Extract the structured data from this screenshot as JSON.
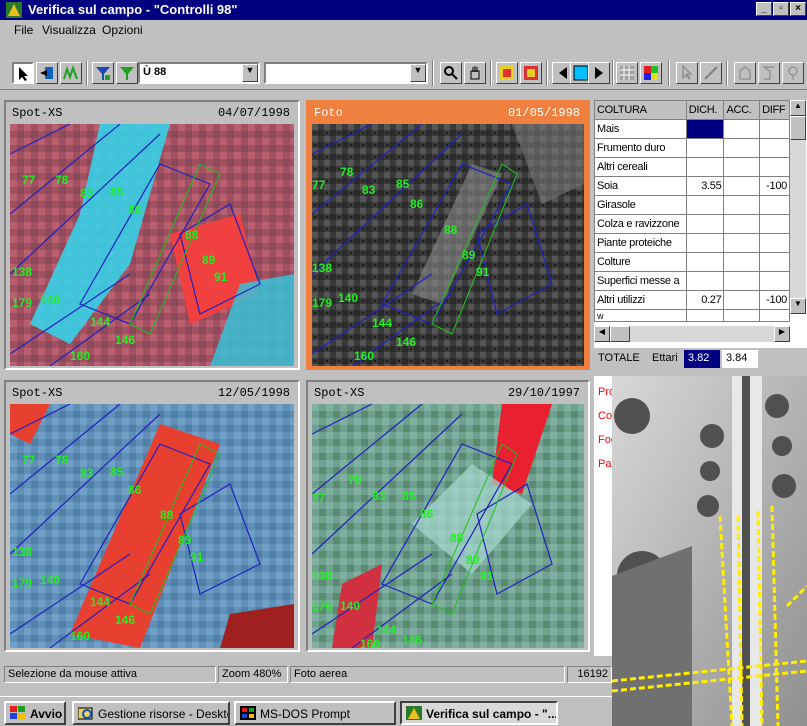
{
  "window": {
    "title": "Verifica sul campo - \"Controlli 98\""
  },
  "menu": [
    {
      "label": "File"
    },
    {
      "label": "Visualizza"
    },
    {
      "label": "Opzioni"
    }
  ],
  "toolbar": {
    "layer_combo": "Ù 88",
    "combo2": "",
    "combo3": ""
  },
  "panels": [
    {
      "label": "Spot-XS",
      "date": "04/07/1998"
    },
    {
      "label": "Foto",
      "date": "01/05/1998"
    },
    {
      "label": "Spot-XS",
      "date": "12/05/1998"
    },
    {
      "label": "Spot-XS",
      "date": "29/10/1997"
    }
  ],
  "parcel_labels": [
    "77",
    "78",
    "83",
    "85",
    "86",
    "88",
    "89",
    "91",
    "138",
    "179",
    "140",
    "144",
    "146",
    "160"
  ],
  "table": {
    "headers": [
      "COLTURA",
      "DICH.",
      "ACC.",
      "DIFF"
    ],
    "rows": [
      {
        "crop": "Mais",
        "dich": "",
        "acc": "",
        "diff": ""
      },
      {
        "crop": "Frumento duro",
        "dich": "",
        "acc": "",
        "diff": ""
      },
      {
        "crop": "Altri cereali",
        "dich": "",
        "acc": "",
        "diff": ""
      },
      {
        "crop": "Soia",
        "dich": "3.55",
        "acc": "",
        "diff": "-100"
      },
      {
        "crop": "Girasole",
        "dich": "",
        "acc": "",
        "diff": ""
      },
      {
        "crop": "Colza e ravizzone",
        "dich": "",
        "acc": "",
        "diff": ""
      },
      {
        "crop": "Piante proteiche",
        "dich": "",
        "acc": "",
        "diff": ""
      },
      {
        "crop": "Colture",
        "dich": "",
        "acc": "",
        "diff": ""
      },
      {
        "crop": "Superfici messe a",
        "dich": "",
        "acc": "",
        "diff": ""
      },
      {
        "crop": "Altri utilizzi",
        "dich": "0.27",
        "acc": "",
        "diff": "-100"
      },
      {
        "crop": "w",
        "dich": "",
        "acc": "",
        "diff": ""
      }
    ],
    "total_label": "TOTALE",
    "total_unit": "Ettari",
    "total_dich": "3.82",
    "total_acc": "3.84"
  },
  "side_links": [
    "Pro",
    "Co",
    "Fog",
    "Pa"
  ],
  "status": {
    "left": "Selezione da mouse attiva",
    "zoom": "Zoom 480%",
    "mode": "Foto aerea",
    "coords": "16192"
  },
  "taskbar": {
    "start": "Avvio",
    "tasks": [
      {
        "label": "Gestione risorse - Desktop"
      },
      {
        "label": "MS-DOS Prompt"
      },
      {
        "label": "Verifica sul campo - \"..."
      }
    ]
  },
  "colors": {
    "title_bg": "#000080",
    "selected_panel": "#f08040",
    "parcel_label": "#22ee22",
    "side_link": "#ff0000"
  }
}
